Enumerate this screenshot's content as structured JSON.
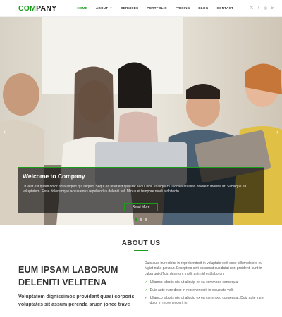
{
  "header": {
    "logo_accent": "COM",
    "logo_rest": "PANY",
    "nav": [
      {
        "label": "HOME",
        "active": true
      },
      {
        "label": "ABOUT",
        "has_dropdown": true
      },
      {
        "label": "SERVICES"
      },
      {
        "label": "PORTFOLIO"
      },
      {
        "label": "PRICING"
      },
      {
        "label": "BLOG"
      },
      {
        "label": "CONTACT"
      }
    ],
    "social": [
      {
        "icon": "twitter-icon",
        "glyph": "𝕏"
      },
      {
        "icon": "facebook-icon",
        "glyph": "f"
      },
      {
        "icon": "instagram-icon",
        "glyph": "◎"
      },
      {
        "icon": "linkedin-icon",
        "glyph": "in"
      }
    ]
  },
  "hero": {
    "title": "Welcome to Company",
    "text": "Ut velit est quam dolor ad a aliquid qui aliquid. Sequi ea ut et est quaerat sequi nihil ut aliquam. Occaecati alias dolorem mollitia ut. Similique ea voluptatem. Esse doloremque accusamus repellendus deleniti vel. Minus et tempore modi architecto.",
    "button_label": "Read More",
    "prev_glyph": "‹",
    "next_glyph": "›",
    "slide_count": 3,
    "active_slide": 1
  },
  "about": {
    "title": "ABOUT US",
    "headline": "EUM IPSAM LABORUM DELENITI VELITENA",
    "subtext": "Voluptatem dignissimos provident quasi corporis voluptates sit assum perenda sruen jonee trave",
    "paragraph": "Duis aute irure dolor in reprehenderit in voluptate velit esse cillum dolore eu fugiat nulla pariatur. Excepteur sint occaecat cupidatat non proident, sunt in culpa qui officia deserunt mollit anim id est laborum",
    "checks": [
      "Ullamco laboris nisi ut aliquip ex ea commodo consequa",
      "Duis aute irure dolor in reprehenderit in voluptate velit",
      "Ullamco laboris nisi ut aliquip ex ea commodo consequat. Duis aute irure dolor in reprehenderit in"
    ]
  },
  "colors": {
    "accent": "#1a9e1a"
  }
}
